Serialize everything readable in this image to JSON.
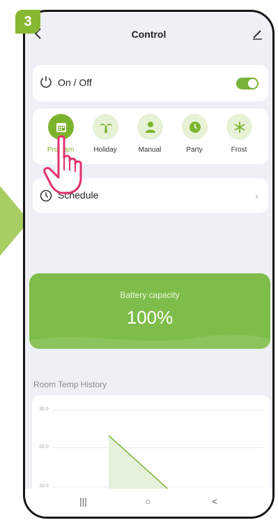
{
  "step": "3",
  "header": {
    "title": "Control",
    "back_icon": "chevron-left-icon",
    "edit_icon": "pen-icon"
  },
  "power": {
    "label": "On / Off",
    "icon": "power-icon",
    "state": "on"
  },
  "modes": [
    {
      "label": "Program",
      "icon": "calendar-icon",
      "active": true
    },
    {
      "label": "Holiday",
      "icon": "palm-tree-icon",
      "active": false
    },
    {
      "label": "Manual",
      "icon": "person-icon",
      "active": false
    },
    {
      "label": "Party",
      "icon": "clock-icon",
      "active": false
    },
    {
      "label": "Frost",
      "icon": "snowflake-icon",
      "active": false
    }
  ],
  "schedule": {
    "label": "Schedule",
    "icon": "clock-icon"
  },
  "battery": {
    "title": "Battery capacity",
    "value": "100%"
  },
  "history": {
    "title": "Room Temp History",
    "ticks": [
      "30.0",
      "20.0",
      "10.0"
    ]
  },
  "colors": {
    "accent": "#7cb32c",
    "battery_bg": "#7ebd49",
    "badge": "#88b832"
  },
  "navbar": {
    "recent": "|||",
    "home": "○",
    "back": "<"
  }
}
